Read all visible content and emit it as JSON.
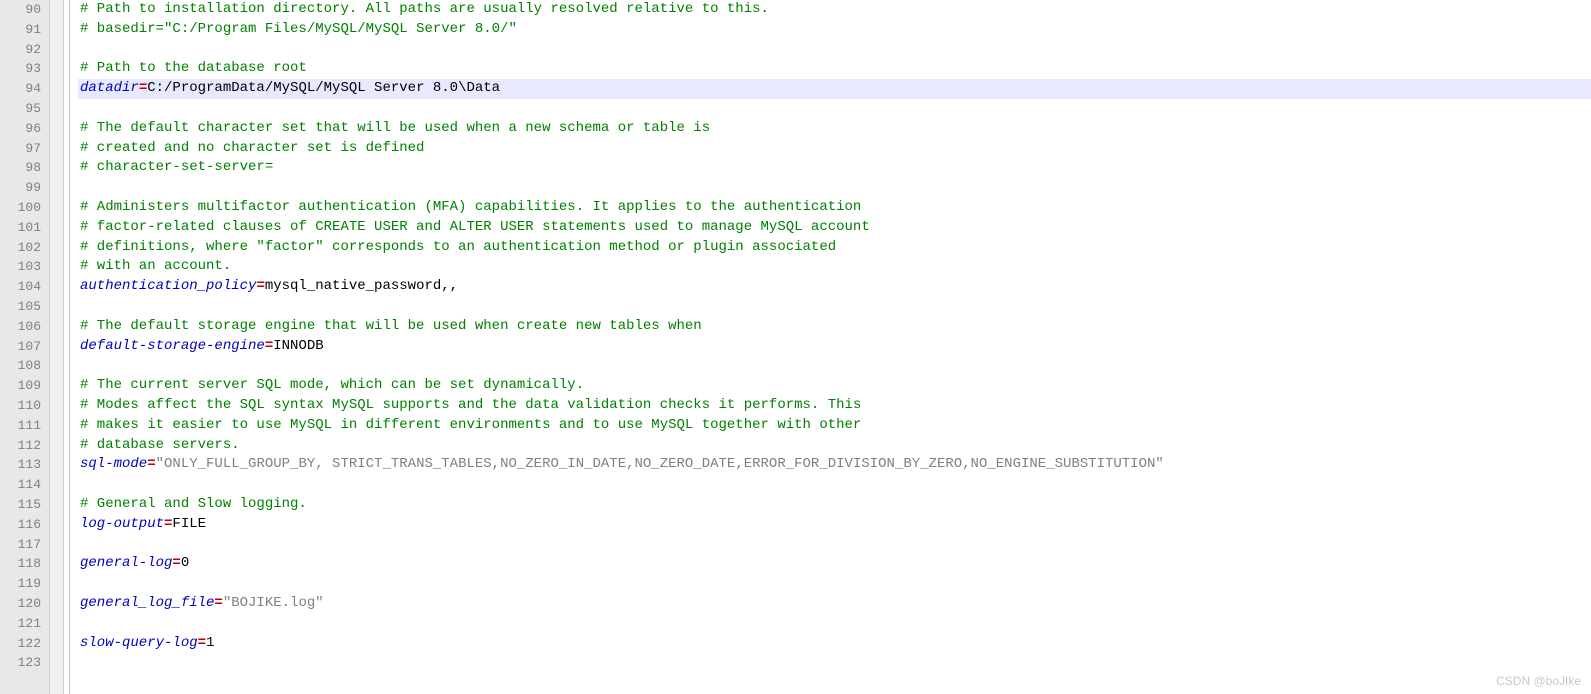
{
  "watermark": "CSDN @boJIke",
  "startLine": 90,
  "highlightedLine": 94,
  "lines": [
    {
      "type": "comment",
      "text": "# Path to installation directory. All paths are usually resolved relative to this."
    },
    {
      "type": "comment",
      "text": "# basedir=\"C:/Program Files/MySQL/MySQL Server 8.0/\""
    },
    {
      "type": "blank",
      "text": ""
    },
    {
      "type": "comment",
      "text": "# Path to the database root"
    },
    {
      "type": "kv",
      "key": "datadir",
      "value": "C:/ProgramData/MySQL/MySQL Server 8.0\\Data"
    },
    {
      "type": "blank",
      "text": ""
    },
    {
      "type": "comment",
      "text": "# The default character set that will be used when a new schema or table is"
    },
    {
      "type": "comment",
      "text": "# created and no character set is defined"
    },
    {
      "type": "comment",
      "text": "# character-set-server="
    },
    {
      "type": "blank",
      "text": ""
    },
    {
      "type": "comment",
      "text": "# Administers multifactor authentication (MFA) capabilities. It applies to the authentication"
    },
    {
      "type": "comment",
      "text": "# factor-related clauses of CREATE USER and ALTER USER statements used to manage MySQL account"
    },
    {
      "type": "comment",
      "text": "# definitions, where \"factor\" corresponds to an authentication method or plugin associated"
    },
    {
      "type": "comment",
      "text": "# with an account."
    },
    {
      "type": "kv",
      "key": "authentication_policy",
      "value": "mysql_native_password,,"
    },
    {
      "type": "blank",
      "text": ""
    },
    {
      "type": "comment",
      "text": "# The default storage engine that will be used when create new tables when"
    },
    {
      "type": "kv",
      "key": "default-storage-engine",
      "value": "INNODB"
    },
    {
      "type": "blank",
      "text": ""
    },
    {
      "type": "comment",
      "text": "# The current server SQL mode, which can be set dynamically."
    },
    {
      "type": "comment",
      "text": "# Modes affect the SQL syntax MySQL supports and the data validation checks it performs. This"
    },
    {
      "type": "comment",
      "text": "# makes it easier to use MySQL in different environments and to use MySQL together with other"
    },
    {
      "type": "comment",
      "text": "# database servers."
    },
    {
      "type": "kv",
      "key": "sql-mode",
      "value": "\"ONLY_FULL_GROUP_BY, STRICT_TRANS_TABLES,NO_ZERO_IN_DATE,NO_ZERO_DATE,ERROR_FOR_DIVISION_BY_ZERO,NO_ENGINE_SUBSTITUTION\"",
      "quoted": true
    },
    {
      "type": "blank",
      "text": ""
    },
    {
      "type": "comment",
      "text": "# General and Slow logging."
    },
    {
      "type": "kv",
      "key": "log-output",
      "value": "FILE"
    },
    {
      "type": "blank",
      "text": ""
    },
    {
      "type": "kv",
      "key": "general-log",
      "value": "0"
    },
    {
      "type": "blank",
      "text": ""
    },
    {
      "type": "kv",
      "key": "general_log_file",
      "value": "\"BOJIKE.log\"",
      "quoted": true
    },
    {
      "type": "blank",
      "text": ""
    },
    {
      "type": "kv",
      "key": "slow-query-log",
      "value": "1"
    },
    {
      "type": "blank",
      "text": ""
    }
  ]
}
